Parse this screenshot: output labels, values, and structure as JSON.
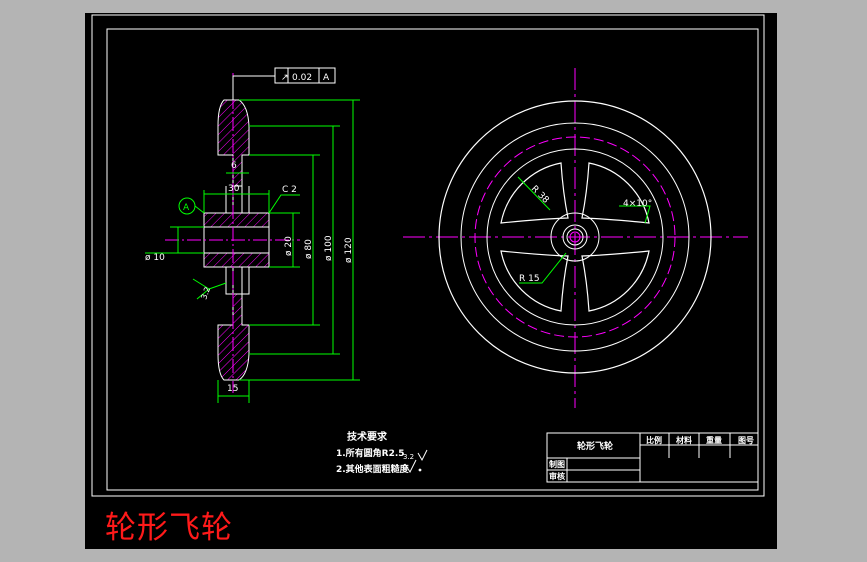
{
  "drawing": {
    "caption": "轮形飞轮",
    "colors": {
      "background": "#b4b4b4",
      "sheet": "#000000",
      "outline": "#ffffff",
      "dimension": "#00ff00",
      "centerline": "#ff00ff",
      "hatch": "#ff00ff",
      "caption": "#ff1a1a"
    },
    "tolerance_frame": {
      "symbol": "↗",
      "value": "0.02",
      "datum": "A"
    },
    "datum_label": "A",
    "dimensions": {
      "width_6": "6",
      "width_30": "30",
      "chamfer": "C 2",
      "dia_10": "ø 10",
      "dia_20": "ø 20",
      "dia_80": "ø 80",
      "dia_100": "ø 100",
      "dia_120": "ø 120",
      "rim_15": "15",
      "roughness": "3.2",
      "radius_38": "R 38",
      "radius_15": "R 15",
      "spokes": "4×10°"
    },
    "tech_requirements": {
      "heading": "技术要求",
      "line1": "1.所有圆角R2.5",
      "line1_roughness": "3.2",
      "line2": "2.其他表面粗糙度"
    },
    "title_block": {
      "part_name": "轮形飞轮",
      "headers": [
        "比例",
        "材料",
        "重量",
        "图号"
      ],
      "row_labels": [
        "制图",
        "审核"
      ]
    }
  }
}
